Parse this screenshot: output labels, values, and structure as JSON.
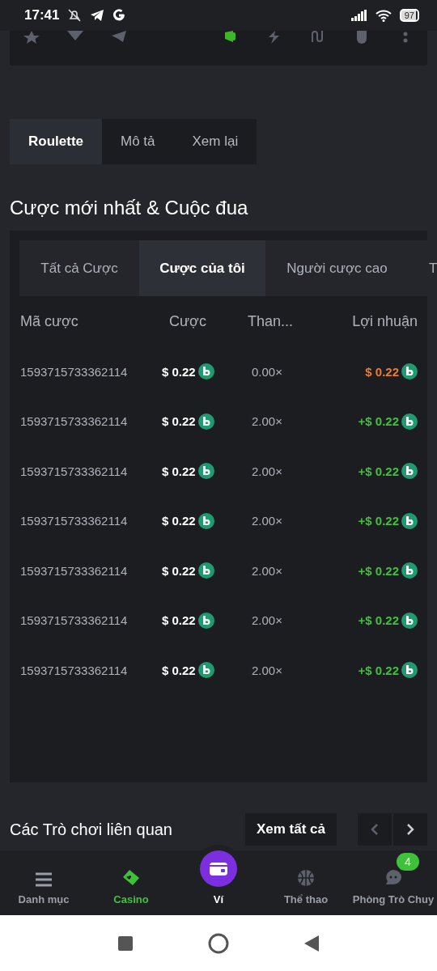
{
  "status_bar": {
    "time": "17:41",
    "battery": "97"
  },
  "game_tabs": [
    {
      "label": "Roulette",
      "selected": true
    },
    {
      "label": "Mô tả",
      "selected": false
    },
    {
      "label": "Xem lại",
      "selected": false
    }
  ],
  "bets_section": {
    "title": "Cược mới nhất & Cuộc đua",
    "tabs": [
      {
        "label": "Tất cả Cược",
        "selected": false
      },
      {
        "label": "Cược của tôi",
        "selected": true
      },
      {
        "label": "Người cược cao",
        "selected": false
      },
      {
        "label": "T",
        "selected": false
      }
    ],
    "table": {
      "columns": [
        "Mã cược",
        "Cược",
        "Than...",
        "Lợi nhuận"
      ],
      "rows": [
        {
          "id": "1593715733362114",
          "bet": "$ 0.22",
          "multiplier": "0.00×",
          "profit": "$ 0.22",
          "kind": "loss"
        },
        {
          "id": "1593715733362114",
          "bet": "$ 0.22",
          "multiplier": "2.00×",
          "profit": "+$ 0.22",
          "kind": "win"
        },
        {
          "id": "1593715733362114",
          "bet": "$ 0.22",
          "multiplier": "2.00×",
          "profit": "+$ 0.22",
          "kind": "win"
        },
        {
          "id": "1593715733362114",
          "bet": "$ 0.22",
          "multiplier": "2.00×",
          "profit": "+$ 0.22",
          "kind": "win"
        },
        {
          "id": "1593715733362114",
          "bet": "$ 0.22",
          "multiplier": "2.00×",
          "profit": "+$ 0.22",
          "kind": "win"
        },
        {
          "id": "1593715733362114",
          "bet": "$ 0.22",
          "multiplier": "2.00×",
          "profit": "+$ 0.22",
          "kind": "win"
        },
        {
          "id": "1593715733362114",
          "bet": "$ 0.22",
          "multiplier": "2.00×",
          "profit": "+$ 0.22",
          "kind": "win"
        }
      ]
    }
  },
  "related": {
    "title": "Các Trò chơi liên quan",
    "view_all": "Xem tất cả"
  },
  "bottom_nav": [
    {
      "label": "Danh mục",
      "kind": "menu",
      "selected": false
    },
    {
      "label": "Casino",
      "kind": "cards",
      "selected": true
    },
    {
      "label": "Ví",
      "kind": "wallet",
      "selected": false
    },
    {
      "label": "Thể thao",
      "kind": "ball",
      "selected": false
    },
    {
      "label": "Phòng Trò Chuy",
      "kind": "chat",
      "selected": false,
      "badge": "4"
    }
  ]
}
